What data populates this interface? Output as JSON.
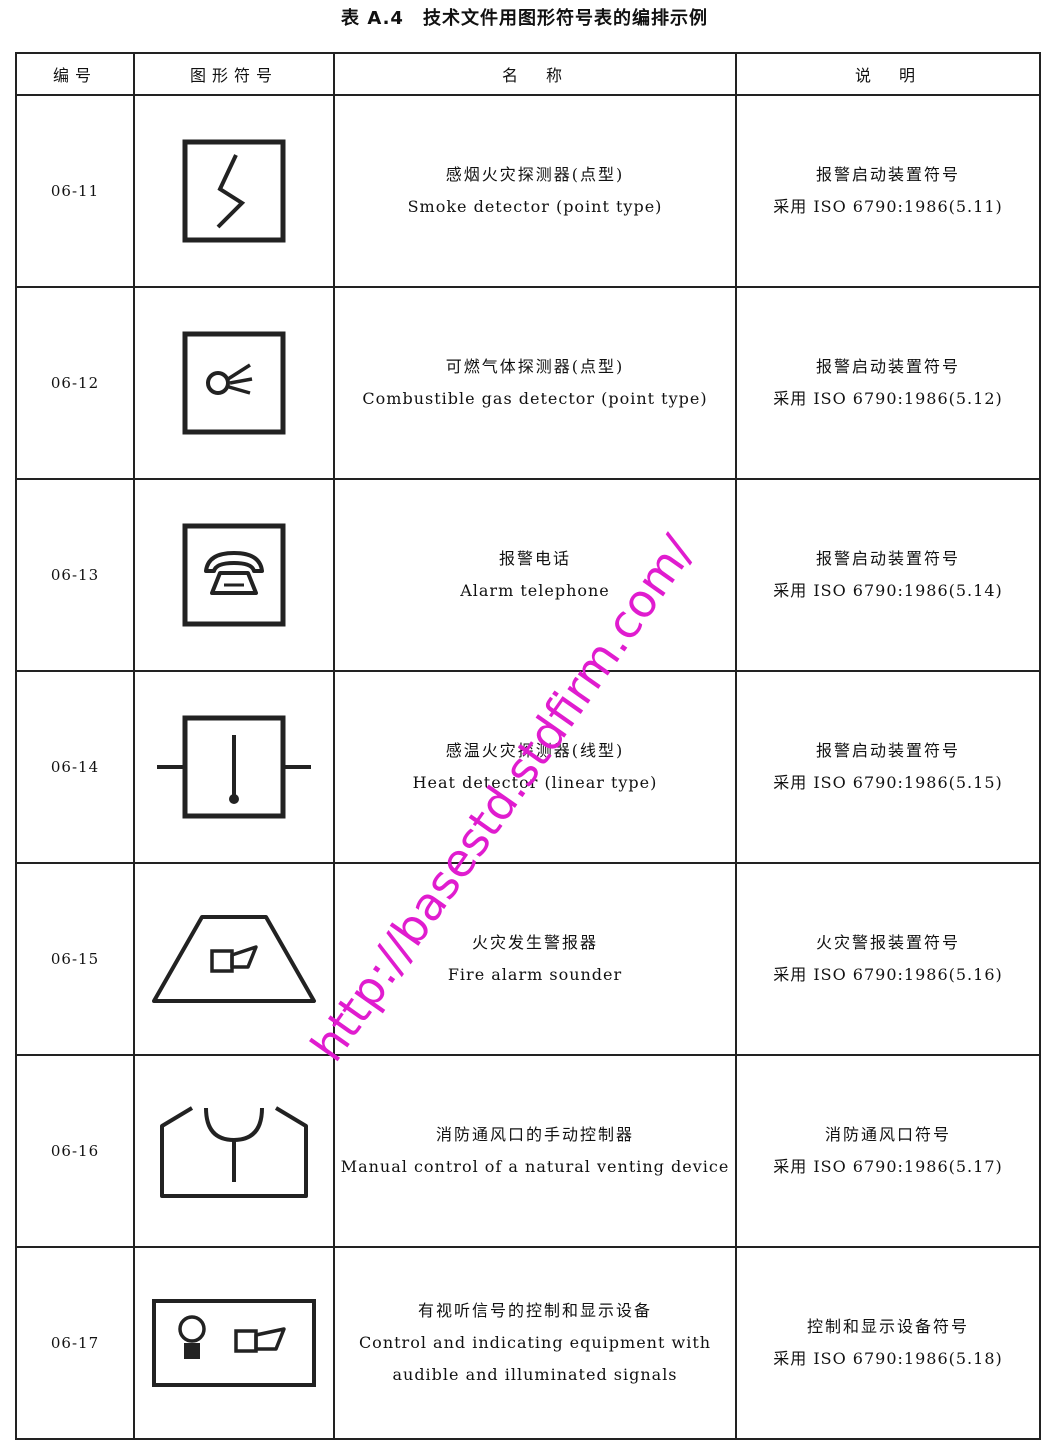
{
  "title": "表 A.4　技术文件用图形符号表的编排示例",
  "header": {
    "col_num": "编号",
    "col_symbol": "图形符号",
    "col_name": "名　称",
    "col_note": "说　明"
  },
  "rows": [
    {
      "num": "06-11",
      "symbol_icon": "smoke-detector-icon",
      "name_zh": "感烟火灾探测器(点型)",
      "name_en": [
        "Smoke detector (point type)"
      ],
      "note_1": "报警启动装置符号",
      "note_2": "采用 ISO 6790:1986(5.11)"
    },
    {
      "num": "06-12",
      "symbol_icon": "gas-detector-icon",
      "name_zh": "可燃气体探测器(点型)",
      "name_en": [
        "Combustible gas detector (point type)"
      ],
      "note_1": "报警启动装置符号",
      "note_2": "采用 ISO 6790:1986(5.12)"
    },
    {
      "num": "06-13",
      "symbol_icon": "alarm-telephone-icon",
      "name_zh": "报警电话",
      "name_en": [
        "Alarm telephone"
      ],
      "note_1": "报警启动装置符号",
      "note_2": "采用 ISO 6790:1986(5.14)"
    },
    {
      "num": "06-14",
      "symbol_icon": "heat-detector-icon",
      "name_zh": "感温火灾探测器(线型)",
      "name_en": [
        "Heat detector (linear type)"
      ],
      "note_1": "报警启动装置符号",
      "note_2": "采用 ISO 6790:1986(5.15)"
    },
    {
      "num": "06-15",
      "symbol_icon": "fire-alarm-sounder-icon",
      "name_zh": "火灾发生警报器",
      "name_en": [
        "Fire alarm sounder"
      ],
      "note_1": "火灾警报装置符号",
      "note_2": "采用 ISO 6790:1986(5.16)"
    },
    {
      "num": "06-16",
      "symbol_icon": "venting-control-icon",
      "name_zh": "消防通风口的手动控制器",
      "name_en": [
        "Manual control of a natural venting device"
      ],
      "note_1": "消防通风口符号",
      "note_2": "采用 ISO 6790:1986(5.17)"
    },
    {
      "num": "06-17",
      "symbol_icon": "control-indicating-equipment-icon",
      "name_zh": "有视听信号的控制和显示设备",
      "name_en": [
        "Control and indicating equipment with",
        "audible and illuminated signals"
      ],
      "note_1": "控制和显示设备符号",
      "note_2": "采用 ISO 6790:1986(5.18)"
    }
  ],
  "watermark": "http://basestd.stdfirm.com/",
  "colors": {
    "line": "#222222",
    "watermark": "#e01ccf"
  }
}
